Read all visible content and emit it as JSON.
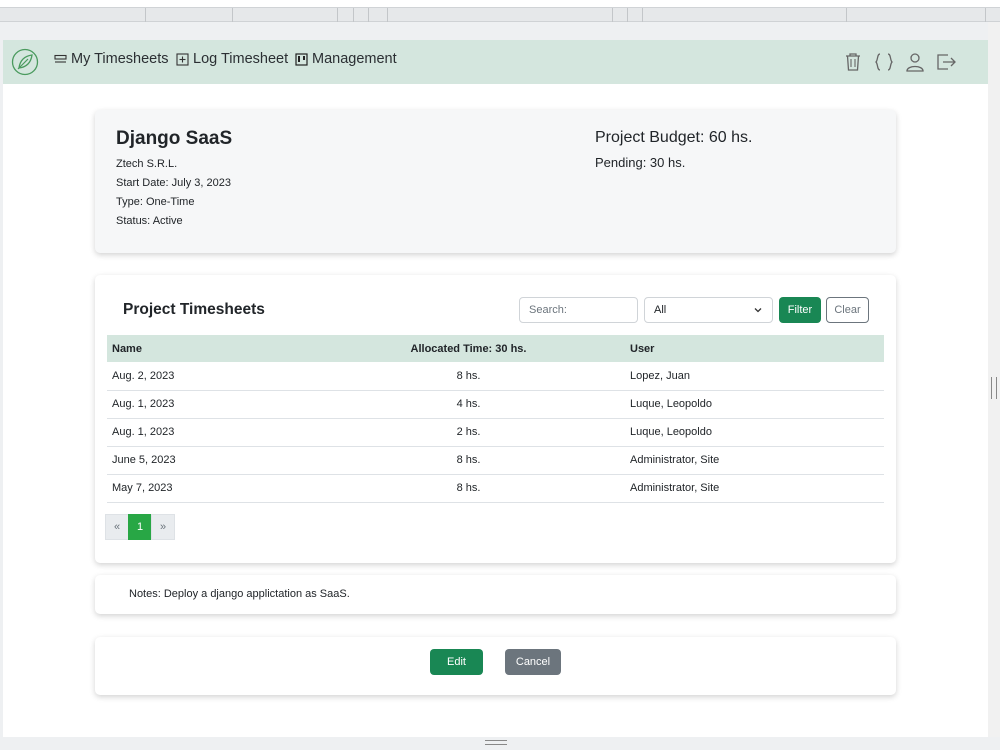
{
  "navbar": {
    "items": [
      {
        "label": "My Timesheets",
        "icon": "list-icon"
      },
      {
        "label": "Log Timesheet",
        "icon": "plus-square-icon"
      },
      {
        "label": "Management",
        "icon": "kanban-icon"
      }
    ],
    "right_icons": [
      "trash-icon",
      "braces-icon",
      "user-icon",
      "logout-icon"
    ],
    "accent": "#d4e6de",
    "logo_icon": "leaf-icon"
  },
  "project": {
    "name": "Django SaaS",
    "client": "Ztech S.R.L.",
    "start_date": "Start Date: July 3, 2023",
    "type": "Type: One-Time",
    "status": "Status: Active",
    "budget": "Project Budget: 60 hs.",
    "pending": "Pending: 30 hs."
  },
  "timesheets": {
    "title": "Project Timesheets",
    "search_placeholder": "Search:",
    "filter_value": "All",
    "filter_label": "Filter",
    "clear_label": "Clear",
    "columns": [
      "Name",
      "Allocated Time: 30 hs.",
      "User"
    ],
    "rows": [
      {
        "name": "Aug. 2, 2023",
        "time": "8 hs.",
        "user": "Lopez, Juan"
      },
      {
        "name": "Aug. 1, 2023",
        "time": "4 hs.",
        "user": "Luque, Leopoldo"
      },
      {
        "name": "Aug. 1, 2023",
        "time": "2 hs.",
        "user": "Luque, Leopoldo"
      },
      {
        "name": "June 5, 2023",
        "time": "8 hs.",
        "user": "Administrator, Site"
      },
      {
        "name": "May 7, 2023",
        "time": "8 hs.",
        "user": "Administrator, Site"
      }
    ],
    "pager": {
      "prev": "«",
      "current": "1",
      "next": "»"
    }
  },
  "notes": "Notes: Deploy a django applictation as SaaS.",
  "actions": {
    "edit": "Edit",
    "cancel": "Cancel"
  },
  "colors": {
    "primary_green": "#198754",
    "page_green": "#28a745",
    "secondary": "#6c757d"
  }
}
